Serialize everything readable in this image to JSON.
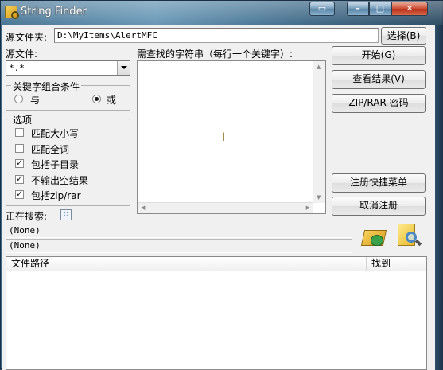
{
  "window": {
    "title": "String Finder"
  },
  "titlebar_buttons": {
    "minimize": "–",
    "maximize": "□",
    "close": "✕"
  },
  "source_folder": {
    "label": "源文件夹:",
    "value": "D:\\MyItems\\AlertMFC",
    "browse_button": "选择(B)"
  },
  "source_file": {
    "label": "源文件:",
    "value": "*.*"
  },
  "keyword_condition": {
    "title": "关键字组合条件",
    "options": [
      {
        "label": "与",
        "selected": false
      },
      {
        "label": "或",
        "selected": true
      }
    ]
  },
  "options": {
    "title": "选项",
    "items": [
      {
        "label": "匹配大小写",
        "checked": false
      },
      {
        "label": "匹配全词",
        "checked": false
      },
      {
        "label": "包括子目录",
        "checked": true
      },
      {
        "label": "不输出空结果",
        "checked": true
      },
      {
        "label": "包括zip/rar",
        "checked": true
      }
    ]
  },
  "search_strings": {
    "label": "需查找的字符串（每行一个关键字）:",
    "value": ""
  },
  "buttons": {
    "start": "开始(G)",
    "view_results": "查看结果(V)",
    "zip_password": "ZIP/RAR 密码",
    "register_menu": "注册快捷菜单",
    "unregister": "取消注册"
  },
  "searching": {
    "label": "正在搜索:",
    "status1": "(None)",
    "status2": "(None)"
  },
  "results_table": {
    "columns": [
      "文件路径",
      "找到"
    ],
    "rows": []
  }
}
